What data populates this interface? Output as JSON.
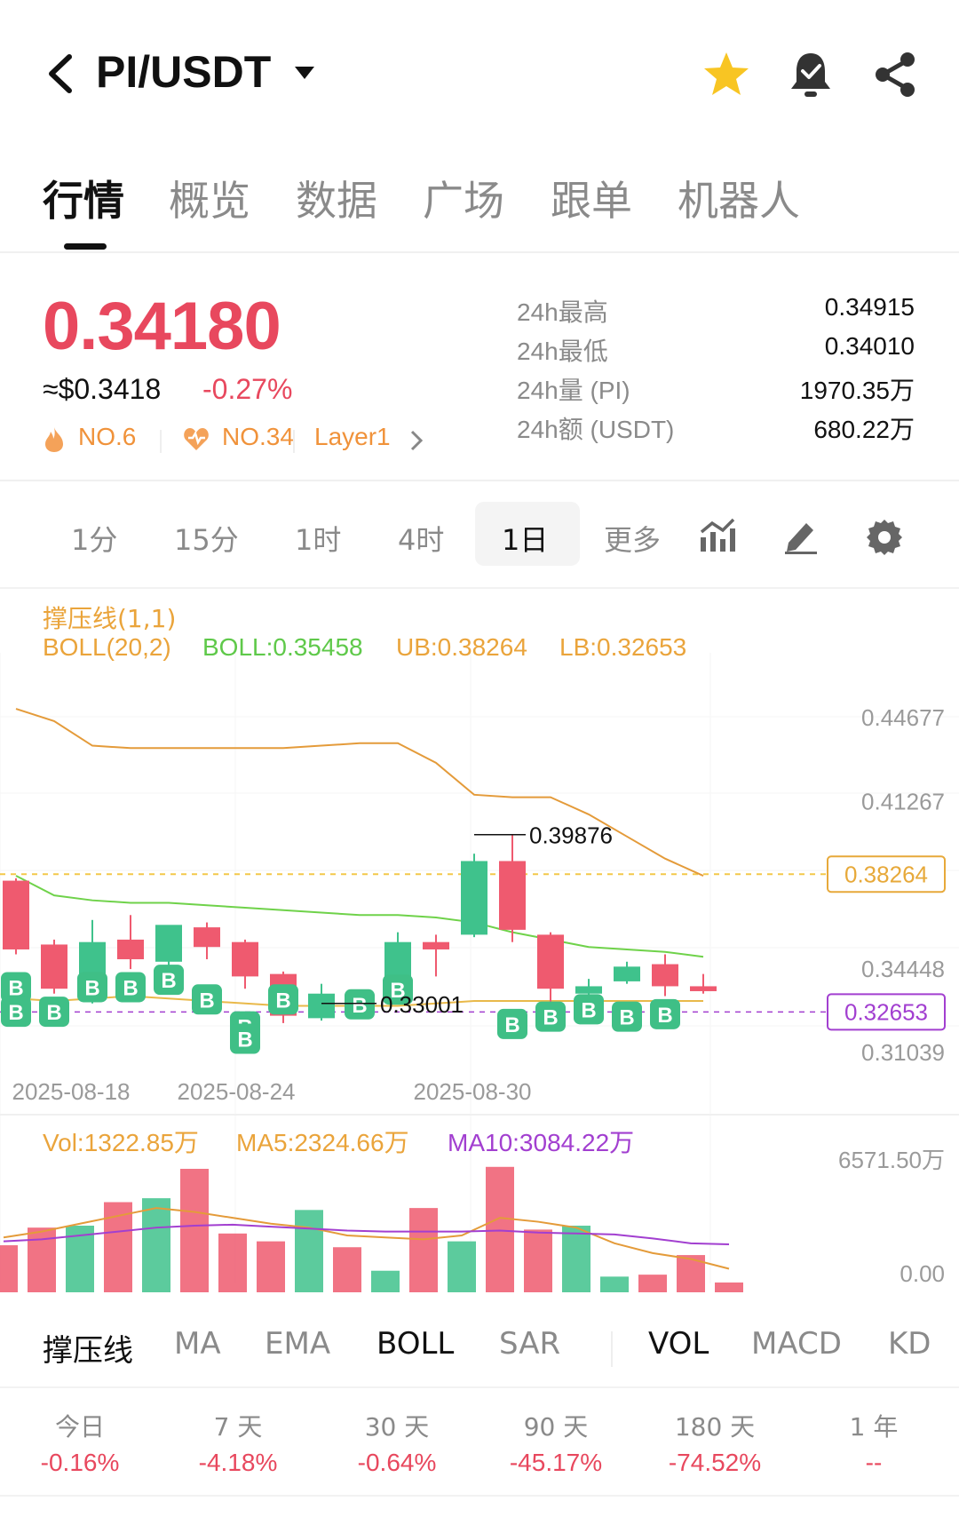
{
  "header": {
    "title": "PI/USDT",
    "icons": [
      "back-icon",
      "dropdown-icon",
      "star-icon",
      "bell-check-icon",
      "share-icon"
    ]
  },
  "tabs": [
    {
      "label": "行情",
      "active": true
    },
    {
      "label": "概览"
    },
    {
      "label": "数据"
    },
    {
      "label": "广场"
    },
    {
      "label": "跟单"
    },
    {
      "label": "机器人"
    }
  ],
  "price": {
    "last": "0.34180",
    "usd": "≈$0.3418",
    "change": "-0.27%",
    "ranks": [
      "NO.6",
      "NO.34",
      "Layer1"
    ],
    "stats": [
      {
        "label": "24h最高",
        "value": "0.34915"
      },
      {
        "label": "24h最低",
        "value": "0.34010"
      },
      {
        "label": "24h量 (PI)",
        "value": "1970.35万"
      },
      {
        "label": "24h额 (USDT)",
        "value": "680.22万"
      }
    ]
  },
  "timeframes": {
    "items": [
      "1分",
      "15分",
      "1时",
      "4时",
      "1日",
      "更多"
    ],
    "active": "1日"
  },
  "indicators": {
    "support": "撑压线(1,1)",
    "boll_params": "BOLL(20,2)",
    "boll": "BOLL:0.35458",
    "ub": "UB:0.38264",
    "lb": "LB:0.32653",
    "vol": "Vol:1322.85万",
    "ma5": "MA5:2324.66万",
    "ma10": "MA10:3084.22万"
  },
  "colors": {
    "up": "#3fc28c",
    "down": "#ef5a6f",
    "ub": "#e49b3a",
    "mid": "#6fd24a",
    "lb": "#a23fd0",
    "ma10": "#a23fd0"
  },
  "chart_data": {
    "type": "candlestick",
    "y_axis_labels": [
      "0.44677",
      "0.41267",
      "0.34448",
      "0.31039"
    ],
    "ub_tag": "0.38264",
    "lb_tag": "0.32653",
    "annot_high": "0.39876",
    "annot_low": "0.33001",
    "x_labels": [
      "2025-08-18",
      "2025-08-24",
      "2025-08-30"
    ],
    "buy_marker": "B",
    "candles": [
      {
        "o": 0.38,
        "h": 0.381,
        "c": 0.352,
        "l": 0.35
      },
      {
        "o": 0.354,
        "h": 0.356,
        "c": 0.336,
        "l": 0.334
      },
      {
        "o": 0.336,
        "h": 0.364,
        "c": 0.355,
        "l": 0.33
      },
      {
        "o": 0.356,
        "h": 0.366,
        "c": 0.348,
        "l": 0.344
      },
      {
        "o": 0.347,
        "h": 0.361,
        "c": 0.362,
        "l": 0.345
      },
      {
        "o": 0.361,
        "h": 0.363,
        "c": 0.353,
        "l": 0.348
      },
      {
        "o": 0.355,
        "h": 0.356,
        "c": 0.341,
        "l": 0.336
      },
      {
        "o": 0.342,
        "h": 0.343,
        "c": 0.325,
        "l": 0.322
      },
      {
        "o": 0.324,
        "h": 0.338,
        "c": 0.334,
        "l": 0.323
      },
      {
        "o": 0.333,
        "h": 0.335,
        "c": 0.331,
        "l": 0.33
      },
      {
        "o": 0.333,
        "h": 0.359,
        "c": 0.355,
        "l": 0.33
      },
      {
        "o": 0.355,
        "h": 0.358,
        "c": 0.352,
        "l": 0.341
      },
      {
        "o": 0.358,
        "h": 0.391,
        "c": 0.388,
        "l": 0.357
      },
      {
        "o": 0.388,
        "h": 0.399,
        "c": 0.36,
        "l": 0.355
      },
      {
        "o": 0.358,
        "h": 0.359,
        "c": 0.336,
        "l": 0.329
      },
      {
        "o": 0.334,
        "h": 0.34,
        "c": 0.337,
        "l": 0.332
      },
      {
        "o": 0.339,
        "h": 0.347,
        "c": 0.345,
        "l": 0.338
      },
      {
        "o": 0.346,
        "h": 0.35,
        "c": 0.337,
        "l": 0.333
      },
      {
        "o": 0.337,
        "h": 0.342,
        "c": 0.335,
        "l": 0.334
      }
    ],
    "ub_line": [
      0.45,
      0.445,
      0.435,
      0.434,
      0.434,
      0.434,
      0.434,
      0.434,
      0.435,
      0.436,
      0.436,
      0.428,
      0.415,
      0.414,
      0.414,
      0.407,
      0.398,
      0.389,
      0.382
    ],
    "mid_line": [
      0.382,
      0.374,
      0.372,
      0.371,
      0.371,
      0.37,
      0.369,
      0.368,
      0.367,
      0.366,
      0.366,
      0.365,
      0.363,
      0.359,
      0.356,
      0.353,
      0.352,
      0.351,
      0.349
    ],
    "lb_line": [
      0.332,
      0.331,
      0.332,
      0.333,
      0.332,
      0.331,
      0.33,
      0.329,
      0.329,
      0.329,
      0.329,
      0.33,
      0.331,
      0.331,
      0.331,
      0.331,
      0.331,
      0.331,
      0.331
    ],
    "buy_marks": [
      [
        0,
        0.337,
        0.327
      ],
      [
        1,
        0.327
      ],
      [
        2,
        0.337
      ],
      [
        3,
        0.337
      ],
      [
        4,
        0.34
      ],
      [
        5,
        0.332
      ],
      [
        6,
        0.321,
        0.316
      ],
      [
        7,
        0.332
      ],
      [
        9,
        0.33
      ],
      [
        10,
        0.336
      ],
      [
        13,
        0.322
      ],
      [
        14,
        0.325
      ],
      [
        15,
        0.328
      ],
      [
        16,
        0.325
      ],
      [
        17,
        0.326
      ]
    ],
    "volume_axis": [
      "6571.50万",
      "0.00"
    ],
    "volume": [
      2400,
      3300,
      3400,
      4600,
      4800,
      6300,
      3000,
      2600,
      4200,
      2300,
      1100,
      4300,
      2600,
      6400,
      3200,
      3400,
      800,
      900,
      1900,
      500
    ],
    "volume_dir": [
      "down",
      "down",
      "up",
      "down",
      "up",
      "down",
      "down",
      "down",
      "up",
      "down",
      "up",
      "down",
      "up",
      "down",
      "down",
      "up",
      "up",
      "down",
      "down",
      "down"
    ],
    "ma5_vol": [
      2800,
      3100,
      3500,
      3900,
      4300,
      4100,
      3800,
      3500,
      3300,
      2900,
      2800,
      2700,
      2900,
      3800,
      3600,
      3300,
      2500,
      2000,
      1700,
      1200
    ],
    "ma10_vol": [
      2600,
      2700,
      2900,
      3100,
      3300,
      3400,
      3450,
      3350,
      3250,
      3150,
      3100,
      3100,
      3100,
      3150,
      3050,
      3000,
      2950,
      2750,
      2500,
      2450
    ]
  },
  "indicator_tabs": {
    "items": [
      "撑压线",
      "MA",
      "EMA",
      "BOLL",
      "SAR",
      "VOL",
      "MACD",
      "KD"
    ],
    "active": [
      "撑压线",
      "BOLL",
      "VOL"
    ]
  },
  "performance": [
    {
      "label": "今日",
      "value": "-0.16%"
    },
    {
      "label": "7 天",
      "value": "-4.18%"
    },
    {
      "label": "30 天",
      "value": "-0.64%"
    },
    {
      "label": "90 天",
      "value": "-45.17%"
    },
    {
      "label": "180 天",
      "value": "-74.52%"
    },
    {
      "label": "1 年",
      "value": "--"
    }
  ]
}
